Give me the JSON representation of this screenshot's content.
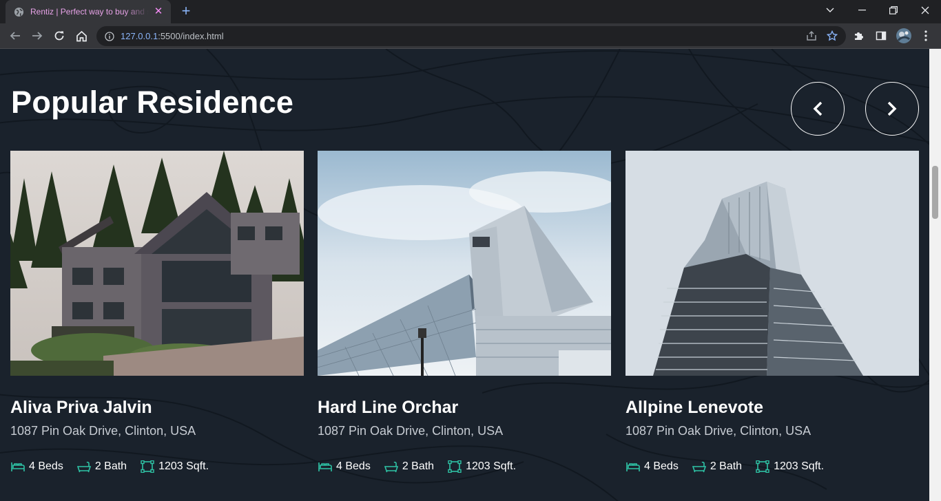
{
  "browser": {
    "tab_title": "Rentiz | Perfect way to buy and sell",
    "url_host": "127.0.0.1",
    "url_rest": ":5500/index.html"
  },
  "section": {
    "title": "Popular Residence"
  },
  "cards": [
    {
      "title": "Aliva Priva Jalvin",
      "address": "1087 Pin Oak Drive, Clinton, USA",
      "beds": "4 Beds",
      "bath": "2 Bath",
      "area": "1203 Sqft."
    },
    {
      "title": "Hard Line Orchar",
      "address": "1087 Pin Oak Drive, Clinton, USA",
      "beds": "4 Beds",
      "bath": "2 Bath",
      "area": "1203 Sqft."
    },
    {
      "title": "Allpine Lenevote",
      "address": "1087 Pin Oak Drive, Clinton, USA",
      "beds": "4 Beds",
      "bath": "2 Bath",
      "area": "1203 Sqft."
    }
  ],
  "colors": {
    "page_bg": "#1a222c",
    "accent": "#2ec4a6",
    "heading": "#ffffff"
  }
}
